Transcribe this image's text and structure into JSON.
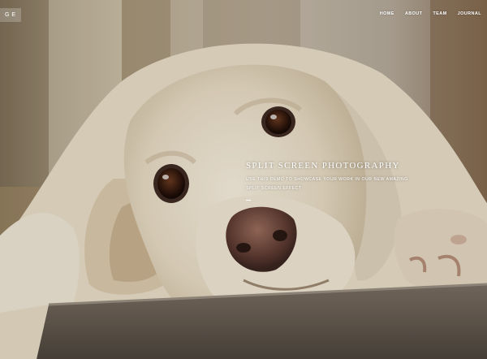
{
  "header": {
    "logo_text": "GE"
  },
  "nav": {
    "items": [
      {
        "label": "HOME"
      },
      {
        "label": "ABOUT"
      },
      {
        "label": "TEAM"
      },
      {
        "label": "JOURNAL"
      }
    ]
  },
  "hero": {
    "title": "SPLIT SCREEN PHOTOGRAPHY",
    "subtitle": "USE THIS DEMO TO SHOWCASE YOUR WORK IN OUR NEW AMAZING SPLIT SCREEN EFFECT"
  },
  "colors": {
    "text": "#ffffff",
    "background": "#2e2a26"
  }
}
